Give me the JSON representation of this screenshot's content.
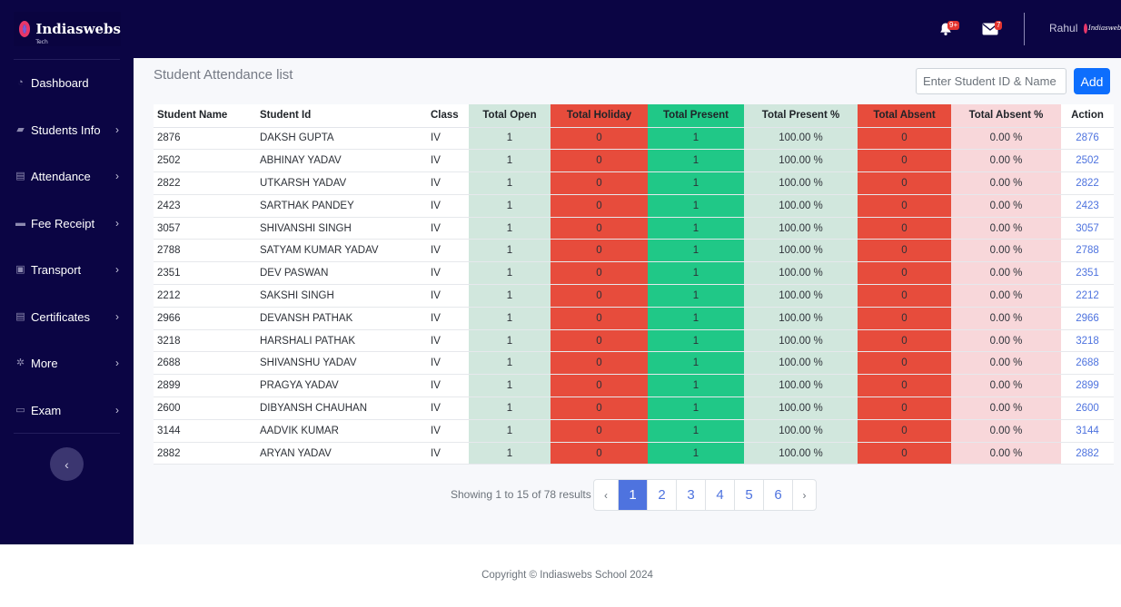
{
  "brand": {
    "name": "Indiaswebs",
    "sub": "Tech"
  },
  "header": {
    "notifications_badge": "9+",
    "messages_badge": "7",
    "user_name": "Rahul",
    "avatar_text": "Indiaswebs"
  },
  "sidebar": {
    "items": [
      {
        "label": "Dashboard",
        "icon": "gauge-icon",
        "chevron": false
      },
      {
        "label": "Students Info",
        "icon": "users-icon",
        "chevron": true
      },
      {
        "label": "Attendance",
        "icon": "copy-icon",
        "chevron": true
      },
      {
        "label": "Fee Receipt",
        "icon": "receipt-icon",
        "chevron": true
      },
      {
        "label": "Transport",
        "icon": "bus-icon",
        "chevron": true
      },
      {
        "label": "Certificates",
        "icon": "certificate-icon",
        "chevron": true
      },
      {
        "label": "More",
        "icon": "gear-icon",
        "chevron": true
      },
      {
        "label": "Exam",
        "icon": "exam-icon",
        "chevron": true
      }
    ],
    "collapse_glyph": "‹"
  },
  "main": {
    "title": "Student Attendance list",
    "search_placeholder": "Enter Student ID & Name",
    "add_label": "Add"
  },
  "table": {
    "headers": [
      "Student Name",
      "Student Id",
      "Class",
      "Total Open",
      "Total Holiday",
      "Total Present",
      "Total Present %",
      "Total Absent",
      "Total Absent %",
      "Action"
    ],
    "rows": [
      [
        "2876",
        "DAKSH GUPTA",
        "IV",
        "1",
        "0",
        "1",
        "100.00 %",
        "0",
        "0.00 %",
        "2876"
      ],
      [
        "2502",
        "ABHINAY YADAV",
        "IV",
        "1",
        "0",
        "1",
        "100.00 %",
        "0",
        "0.00 %",
        "2502"
      ],
      [
        "2822",
        "UTKARSH YADAV",
        "IV",
        "1",
        "0",
        "1",
        "100.00 %",
        "0",
        "0.00 %",
        "2822"
      ],
      [
        "2423",
        "SARTHAK PANDEY",
        "IV",
        "1",
        "0",
        "1",
        "100.00 %",
        "0",
        "0.00 %",
        "2423"
      ],
      [
        "3057",
        "SHIVANSHI SINGH",
        "IV",
        "1",
        "0",
        "1",
        "100.00 %",
        "0",
        "0.00 %",
        "3057"
      ],
      [
        "2788",
        "SATYAM KUMAR YADAV",
        "IV",
        "1",
        "0",
        "1",
        "100.00 %",
        "0",
        "0.00 %",
        "2788"
      ],
      [
        "2351",
        "DEV PASWAN",
        "IV",
        "1",
        "0",
        "1",
        "100.00 %",
        "0",
        "0.00 %",
        "2351"
      ],
      [
        "2212",
        "SAKSHI SINGH",
        "IV",
        "1",
        "0",
        "1",
        "100.00 %",
        "0",
        "0.00 %",
        "2212"
      ],
      [
        "2966",
        "DEVANSH PATHAK",
        "IV",
        "1",
        "0",
        "1",
        "100.00 %",
        "0",
        "0.00 %",
        "2966"
      ],
      [
        "3218",
        "HARSHALI PATHAK",
        "IV",
        "1",
        "0",
        "1",
        "100.00 %",
        "0",
        "0.00 %",
        "3218"
      ],
      [
        "2688",
        "SHIVANSHU YADAV",
        "IV",
        "1",
        "0",
        "1",
        "100.00 %",
        "0",
        "0.00 %",
        "2688"
      ],
      [
        "2899",
        "PRAGYA YADAV",
        "IV",
        "1",
        "0",
        "1",
        "100.00 %",
        "0",
        "0.00 %",
        "2899"
      ],
      [
        "2600",
        "DIBYANSH CHAUHAN",
        "IV",
        "1",
        "0",
        "1",
        "100.00 %",
        "0",
        "0.00 %",
        "2600"
      ],
      [
        "3144",
        "AADVIK KUMAR",
        "IV",
        "1",
        "0",
        "1",
        "100.00 %",
        "0",
        "0.00 %",
        "3144"
      ],
      [
        "2882",
        "ARYAN YADAV",
        "IV",
        "1",
        "0",
        "1",
        "100.00 %",
        "0",
        "0.00 %",
        "2882"
      ]
    ]
  },
  "pagination": {
    "info": "Showing 1 to 15 of 78 results",
    "prev": "‹",
    "next": "›",
    "pages": [
      "1",
      "2",
      "3",
      "4",
      "5",
      "6"
    ],
    "current": "1"
  },
  "footer": {
    "copyright": "Copyright © Indiaswebs School 2024"
  },
  "colors": {
    "nav_bg": "#0b0544",
    "holiday": "#e74c3c",
    "present": "#20c887",
    "open": "#d1e7dd",
    "absent_pct": "#f8d7da",
    "primary": "#0d6efd"
  }
}
